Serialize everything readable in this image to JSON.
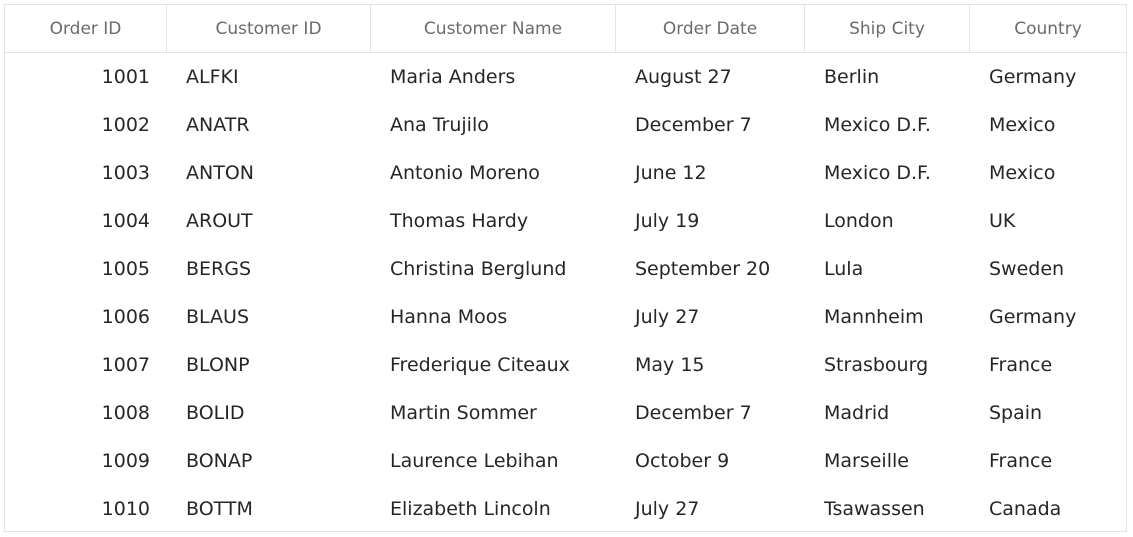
{
  "grid": {
    "columns": [
      "Order ID",
      "Customer ID",
      "Customer Name",
      "Order Date",
      "Ship City",
      "Country"
    ],
    "rows": [
      [
        "1001",
        "ALFKI",
        "Maria Anders",
        "August 27",
        "Berlin",
        "Germany"
      ],
      [
        "1002",
        "ANATR",
        "Ana Trujilo",
        "December 7",
        "Mexico D.F.",
        "Mexico"
      ],
      [
        "1003",
        "ANTON",
        "Antonio Moreno",
        "June 12",
        "Mexico D.F.",
        "Mexico"
      ],
      [
        "1004",
        "AROUT",
        "Thomas Hardy",
        "July 19",
        "London",
        "UK"
      ],
      [
        "1005",
        "BERGS",
        "Christina Berglund",
        "September 20",
        "Lula",
        "Sweden"
      ],
      [
        "1006",
        "BLAUS",
        "Hanna Moos",
        "July 27",
        "Mannheim",
        "Germany"
      ],
      [
        "1007",
        "BLONP",
        "Frederique Citeaux",
        "May 15",
        "Strasbourg",
        "France"
      ],
      [
        "1008",
        "BOLID",
        "Martin Sommer",
        "December 7",
        "Madrid",
        "Spain"
      ],
      [
        "1009",
        "BONAP",
        "Laurence Lebihan",
        "October 9",
        "Marseille",
        "France"
      ],
      [
        "1010",
        "BOTTM",
        "Elizabeth Lincoln",
        "July 27",
        "Tsawassen",
        "Canada"
      ]
    ]
  }
}
